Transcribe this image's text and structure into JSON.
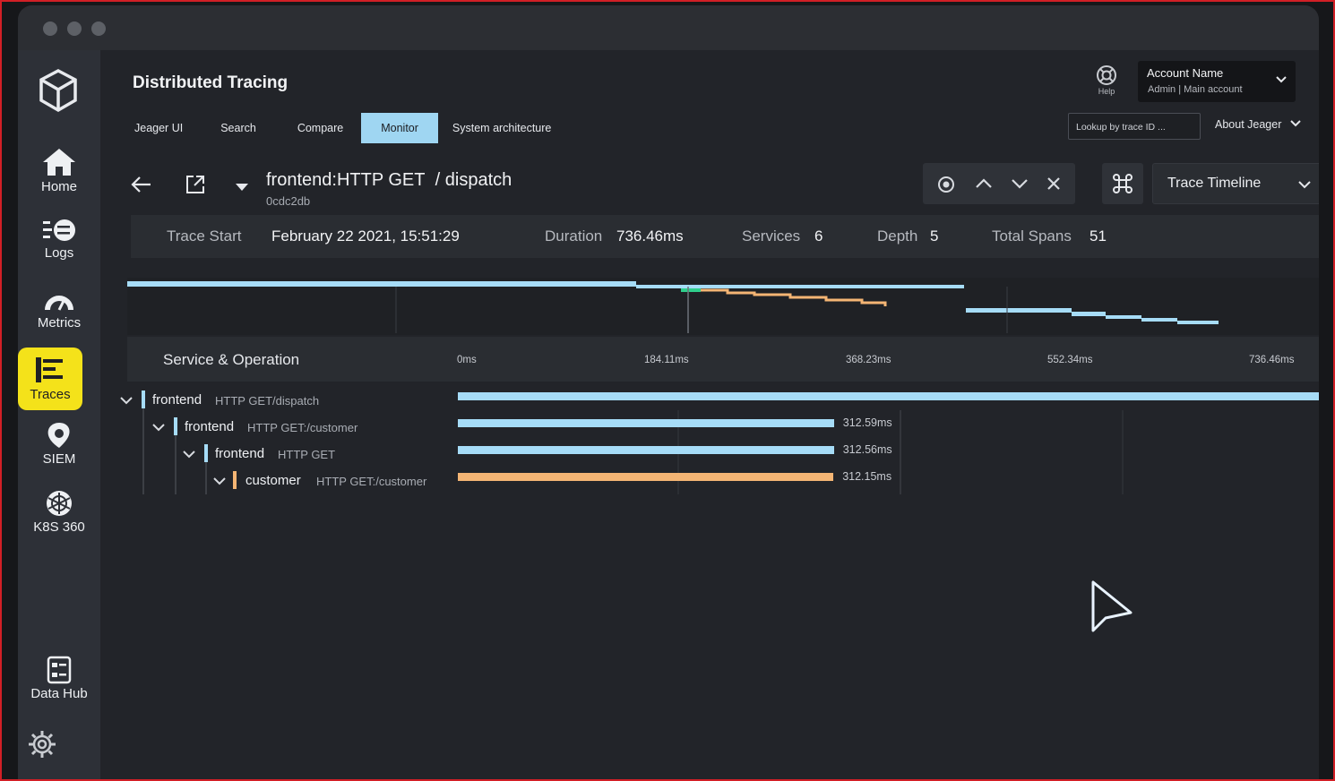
{
  "header": {
    "app_title": "Distributed Tracing",
    "help_label": "Help",
    "account_name": "Account Name",
    "account_sub": "Admin  |  Main account"
  },
  "nav": [
    {
      "label": "Jeager UI",
      "active": false
    },
    {
      "label": "Search",
      "active": false
    },
    {
      "label": "Compare",
      "active": false
    },
    {
      "label": "Monitor",
      "active": true
    },
    {
      "label": "System architecture",
      "active": false
    }
  ],
  "lookup": {
    "placeholder": "Lookup by trace ID ..."
  },
  "about": {
    "label": "About Jeager"
  },
  "sidebar": [
    {
      "label": "Home",
      "icon": "home-icon"
    },
    {
      "label": "Logs",
      "icon": "logs-icon"
    },
    {
      "label": "Metrics",
      "icon": "metrics-icon"
    },
    {
      "label": "Traces",
      "icon": "traces-icon",
      "active": true
    },
    {
      "label": "SIEM",
      "icon": "siem-icon"
    },
    {
      "label": "K8S 360",
      "icon": "k8s-icon"
    },
    {
      "label": "Data Hub",
      "icon": "data-hub-icon"
    }
  ],
  "trace": {
    "service": "frontend:HTTP GET",
    "operation": "/ dispatch",
    "id": "0cdc2db",
    "view_select": "Trace Timeline"
  },
  "stats": {
    "start_label": "Trace Start",
    "start_value": "February 22 2021, 15:51:29",
    "duration_label": "Duration",
    "duration_value": "736.46ms",
    "services_label": "Services",
    "services_value": "6",
    "depth_label": "Depth",
    "depth_value": "5",
    "spans_label": "Total Spans",
    "spans_value": "51"
  },
  "timeline": {
    "header_label": "Service & Operation",
    "ticks": [
      "0ms",
      "184.11ms",
      "368.23ms",
      "552.34ms",
      "736.46ms"
    ],
    "total_ms": 736.46
  },
  "spans": [
    {
      "service": "frontend",
      "operation": "HTTP GET/dispatch",
      "duration": "",
      "start_ms": 0,
      "duration_ms": 736.46,
      "color": "#a6dcf7"
    },
    {
      "service": "frontend",
      "operation": "HTTP GET:/customer",
      "duration": "312.59ms",
      "start_ms": 0,
      "duration_ms": 312.59,
      "color": "#a6dcf7"
    },
    {
      "service": "frontend",
      "operation": "HTTP GET",
      "duration": "312.56ms",
      "start_ms": 0,
      "duration_ms": 312.56,
      "color": "#a6dcf7"
    },
    {
      "service": "customer",
      "operation": "HTTP GET:/customer",
      "duration": "312.15ms",
      "start_ms": 0,
      "duration_ms": 312.15,
      "color": "#f4b574"
    }
  ],
  "colors": {
    "accent": "#f4e21a",
    "tab_active": "#9fd6f2",
    "span_blue": "#a6dcf7",
    "span_orange": "#f4b574"
  }
}
